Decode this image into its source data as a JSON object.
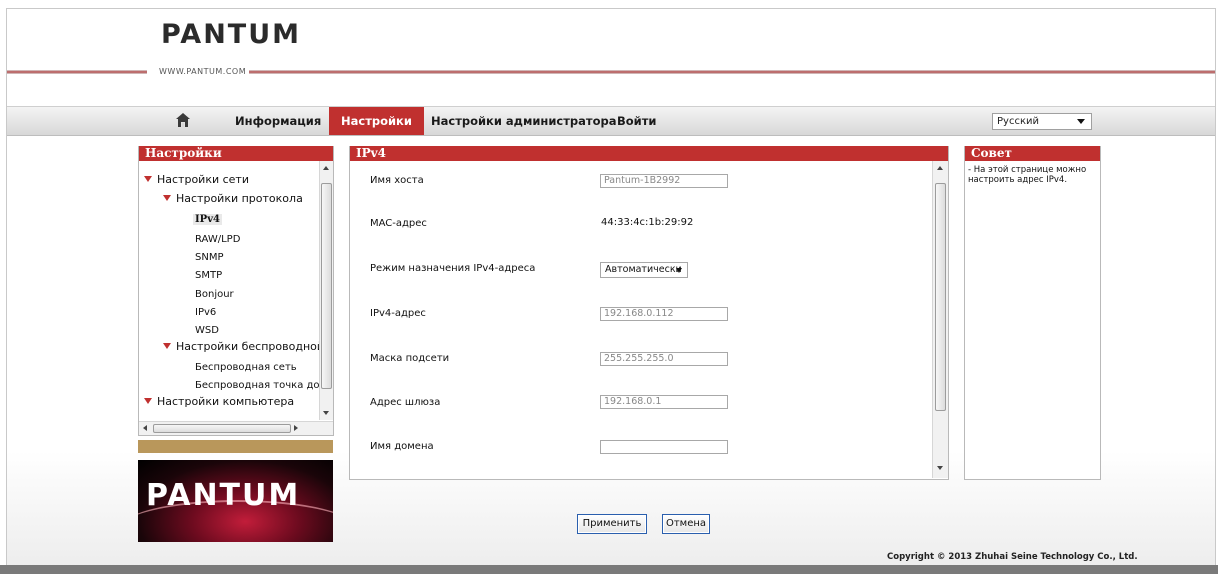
{
  "header": {
    "logo": "PANTUM",
    "logo_url": "WWW.PANTUM.COM"
  },
  "nav": {
    "home_icon": "home-icon",
    "items": [
      {
        "label": "Информация",
        "active": false
      },
      {
        "label": "Настройки",
        "active": true
      },
      {
        "label": "Настройки администратора",
        "active": false
      },
      {
        "label": "Войти",
        "active": false
      }
    ],
    "language": "Русский"
  },
  "left_panel": {
    "title": "Настройки",
    "tree": [
      {
        "label": "Настройки сети",
        "level": 1,
        "expanded": true
      },
      {
        "label": "Настройки протокола",
        "level": 2,
        "expanded": true
      },
      {
        "label": "IPv4",
        "level": 3,
        "active": true
      },
      {
        "label": "RAW/LPD",
        "level": 3
      },
      {
        "label": "SNMP",
        "level": 3
      },
      {
        "label": "SMTP",
        "level": 3
      },
      {
        "label": "Bonjour",
        "level": 3
      },
      {
        "label": "IPv6",
        "level": 3
      },
      {
        "label": "WSD",
        "level": 3
      },
      {
        "label": "Настройки беспроводной сети",
        "level": 2,
        "expanded": true
      },
      {
        "label": "Беспроводная сеть",
        "level": 3
      },
      {
        "label": "Беспроводная точка доступа",
        "level": 3
      },
      {
        "label": "Настройки компьютера",
        "level": 1,
        "expanded": true
      }
    ],
    "brand_logo": "PANTUM"
  },
  "center_panel": {
    "title": "IPv4",
    "fields": [
      {
        "label": "Имя хоста",
        "type": "input",
        "value": "Pantum-1B2992"
      },
      {
        "label": "MAC-адрес",
        "type": "text",
        "value": "44:33:4c:1b:29:92"
      },
      {
        "label": "Режим назначения IPv4-адреса",
        "type": "select",
        "value": "Автоматически"
      },
      {
        "label": "IPv4-адрес",
        "type": "input",
        "value": "192.168.0.112"
      },
      {
        "label": "Маска подсети",
        "type": "input",
        "value": "255.255.255.0"
      },
      {
        "label": "Адрес шлюза",
        "type": "input",
        "value": "192.168.0.1"
      },
      {
        "label": "Имя домена",
        "type": "input",
        "value": ""
      }
    ]
  },
  "right_panel": {
    "title": "Совет",
    "tip": "- На этой странице можно настроить адрес IPv4."
  },
  "buttons": {
    "apply": "Применить",
    "cancel": "Отмена"
  },
  "footer": {
    "copyright": "Copyright © 2013 Zhuhai Seine Technology Co., Ltd."
  },
  "colors": {
    "accent": "#c0302f",
    "tan": "#b9975b",
    "button_border": "#2a5fae"
  }
}
